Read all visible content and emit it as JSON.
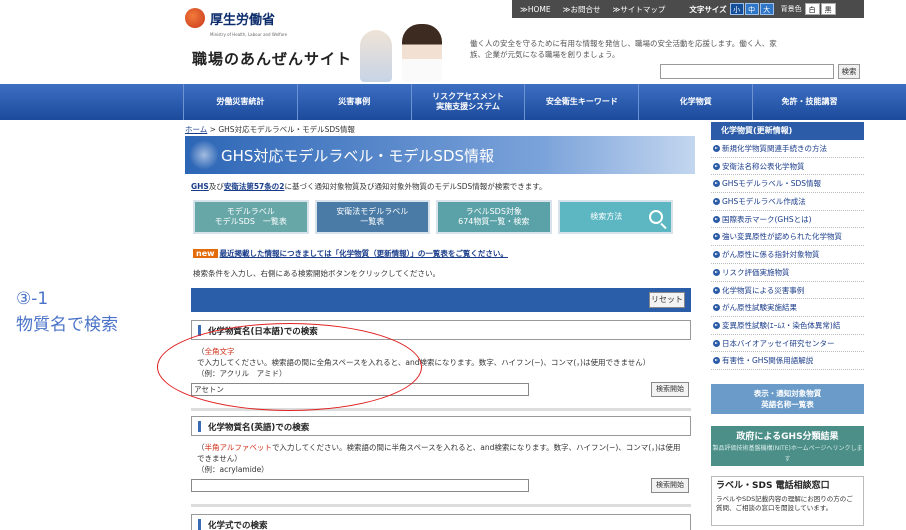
{
  "header": {
    "logo_text": "厚生労働省",
    "logo_sub": "Ministry of Health, Labour and Welfare",
    "site_title": "職場のあんぜんサイト",
    "tagline": "働く人の安全を守るために有用な情報を発信し、職場の安全活動を応援します。働く人、家族、企業が元気になる職場を創りましょう。",
    "search_button": "検索",
    "top_links": [
      "≫HOME",
      "≫お問合せ",
      "≫サイトマップ"
    ],
    "font_size_label": "文字サイズ",
    "font_sizes": [
      "小",
      "中",
      "大"
    ],
    "bg_label": "背景色",
    "bg_options": [
      "白",
      "黒"
    ]
  },
  "nav": {
    "items": [
      "労働災害統計",
      "災害事例",
      "リスクアセスメント\n実施支援システム",
      "安全衛生キーワード",
      "化学物質",
      "免許・技能講習"
    ]
  },
  "main": {
    "breadcrumb_home": "ホーム",
    "breadcrumb_sep": ">",
    "breadcrumb_current": "GHS対応モデルラベル・モデルSDS情報",
    "page_title": "GHS対応モデルラベル・モデルSDS情報",
    "intro_link1": "GHS",
    "intro_mid": "及び",
    "intro_link2": "安衛法第57条の2",
    "intro_rest": "に基づく通知対象物質及び通知対象外物質のモデルSDS情報が検索できます。",
    "quick_buttons": [
      "モデルラベル\nモデルSDS　一覧表",
      "安衛法モデルラベル\n一覧表",
      "ラベルSDS対象\n674物質一覧・検索",
      "検索方法"
    ],
    "news_badge": "new",
    "news_text": "最近掲載した情報につきましては「化学物質（更新情報）」の一覧表をご覧ください。",
    "instruction": "検索条件を入力し、右側にある検索開始ボタンをクリックしてください。",
    "reset_button": "リセット",
    "sections": [
      {
        "title": "化学物質名(日本語)での検索",
        "desc_hl": "全角文字",
        "desc_pre": "（",
        "desc_rest": "で入力してください。検索語の間に全角スペースを入れると、and検索になります。数字、ハイフン(−)、コンマ(，)は使用できません）",
        "example": "（例：アクリル　アミド）",
        "value": "アセトン",
        "button": "検索開始"
      },
      {
        "title": "化学物質名(英語)での検索",
        "desc_hl": "半角アルファベット",
        "desc_pre": "（",
        "desc_rest": "で入力してください。検索語の間に半角スペースを入れると、and検索になります。数字、ハイフン(−)、コンマ(，)は使用できません）",
        "example": "（例：acrylamide）",
        "value": "",
        "button": "検索開始"
      },
      {
        "title": "化学式での検索"
      }
    ]
  },
  "sidebar": {
    "heading": "化学物質(更新情報)",
    "items": [
      "新規化学物質関連手続きの方法",
      "安衛法名称公表化学物質",
      "GHSモデルラベル・SDS情報",
      "GHSモデルラベル作成法",
      "国際表示マーク(GHSとは)",
      "強い変異原性が認められた化学物質",
      "がん原性に係る指針対象物質",
      "リスク評価実施物質",
      "化学物質による災害事例",
      "がん原性試験実施結果",
      "変異原性試験(ｴｰﾑｽ・染色体異常)結",
      "日本バイオアッセイ研究センター",
      "有害性・GHS関係用語解説"
    ],
    "box1": "表示・通知対象物質\n英語名称一覧表",
    "box2_big": "政府によるGHS分類結果",
    "box2_small": "製品評価技術基盤機構(NITE)ホームページへリンクします",
    "box3_title": "ラベル・SDS 電話相談窓口",
    "box3_desc": "ラベルやSDS記載内容の理解にお困りの方のご質問、ご相談の窓口を開設しています。"
  },
  "annotation": {
    "line1": "③-1",
    "line2": "物質名で検索"
  },
  "colors": {
    "nav_blue": "#1c4b9c",
    "accent_red": "#d0301a",
    "annotation_blue": "#4a73c8",
    "ellipse_red": "#e02020"
  }
}
